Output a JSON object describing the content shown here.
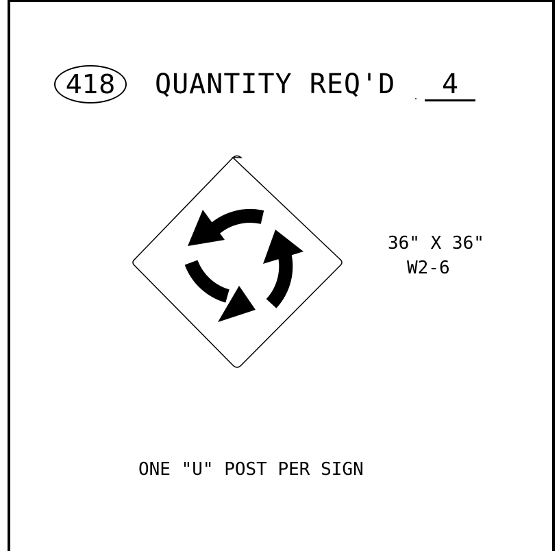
{
  "header": {
    "sign_number": "418",
    "quantity_label": "QUANTITY REQ'D",
    "quantity_value": "4"
  },
  "sign": {
    "size": "36\" X 36\"",
    "code": "W2-6",
    "symbol_icon": "roundabout-circular-arrows-icon",
    "colors": {
      "border": "#000000",
      "symbol": "#000000",
      "background": "#ffffff"
    }
  },
  "notes": {
    "post": "ONE \"U\" POST PER SIGN"
  }
}
